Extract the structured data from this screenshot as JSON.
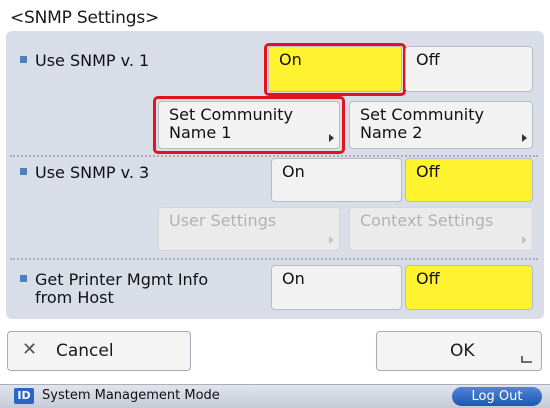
{
  "title": "<SNMP Settings>",
  "snmp_v1": {
    "label": "Use SNMP v. 1",
    "on_label": "On",
    "off_label": "Off",
    "selected": "On",
    "community1_line1": "Set Community",
    "community1_line2": "Name 1",
    "community2_line1": "Set Community",
    "community2_line2": "Name 2"
  },
  "snmp_v3": {
    "label": "Use SNMP v. 3",
    "on_label": "On",
    "off_label": "Off",
    "selected": "Off",
    "user_settings_label": "User Settings",
    "context_settings_label": "Context Settings"
  },
  "printer_mgmt": {
    "label_line1": "Get Printer Mgmt Info",
    "label_line2": "from Host",
    "on_label": "On",
    "off_label": "Off",
    "selected": "Off"
  },
  "footer": {
    "cancel_label": "Cancel",
    "ok_label": "OK"
  },
  "statusbar": {
    "id_badge": "ID",
    "mode_text": "System Management Mode",
    "logout_label": "Log Out"
  },
  "colors": {
    "selected": "#fff22e",
    "highlight_outline": "#e0141e",
    "panel": "#d9dde8"
  },
  "icons": {
    "cancel": "close-icon",
    "ok": "corner-return-icon",
    "submenu": "submenu-arrow-icon"
  }
}
